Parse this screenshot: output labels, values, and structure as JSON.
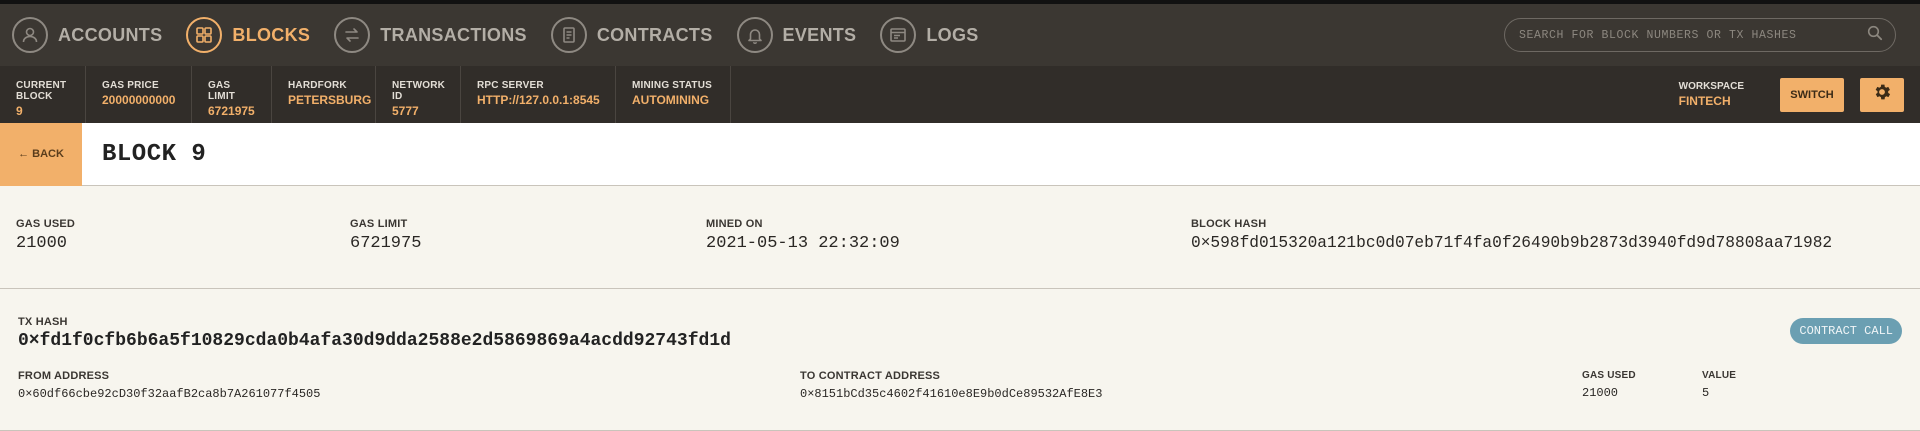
{
  "nav": {
    "items": [
      {
        "label": "ACCOUNTS",
        "icon": "account-icon"
      },
      {
        "label": "BLOCKS",
        "icon": "blocks-icon"
      },
      {
        "label": "TRANSACTIONS",
        "icon": "transactions-icon"
      },
      {
        "label": "CONTRACTS",
        "icon": "contracts-icon"
      },
      {
        "label": "EVENTS",
        "icon": "bell-icon"
      },
      {
        "label": "LOGS",
        "icon": "logs-icon"
      }
    ],
    "active": "BLOCKS",
    "search_placeholder": "SEARCH FOR BLOCK NUMBERS OR TX HASHES"
  },
  "status": {
    "current_block": {
      "label": "CURRENT BLOCK",
      "value": "9"
    },
    "gas_price": {
      "label": "GAS PRICE",
      "value": "20000000000"
    },
    "gas_limit": {
      "label": "GAS LIMIT",
      "value": "6721975"
    },
    "hardfork": {
      "label": "HARDFORK",
      "value": "PETERSBURG"
    },
    "network_id": {
      "label": "NETWORK ID",
      "value": "5777"
    },
    "rpc_server": {
      "label": "RPC SERVER",
      "value": "HTTP://127.0.0.1:8545"
    },
    "mining_status": {
      "label": "MINING STATUS",
      "value": "AUTOMINING"
    },
    "workspace": {
      "label": "WORKSPACE",
      "value": "FINTECH"
    },
    "switch_label": "SWITCH"
  },
  "page": {
    "back_label": "← BACK",
    "title": "BLOCK 9"
  },
  "block": {
    "gas_used": {
      "label": "GAS USED",
      "value": "21000"
    },
    "gas_limit": {
      "label": "GAS LIMIT",
      "value": "6721975"
    },
    "mined_on": {
      "label": "MINED ON",
      "value": "2021-05-13 22:32:09"
    },
    "block_hash": {
      "label": "BLOCK HASH",
      "value": "0×598fd015320a121bc0d07eb71f4fa0f26490b9b2873d3940fd9d78808aa71982"
    }
  },
  "transaction": {
    "hash_label": "TX HASH",
    "hash": "0×fd1f0cfb6b6a5f10829cda0b4afa30d9dda2588e2d5869869a4acdd92743fd1d",
    "type": "CONTRACT CALL",
    "from": {
      "label": "FROM ADDRESS",
      "value": "0×60df66cbe92cD30f32aafB2ca8b7A261077f4505"
    },
    "to": {
      "label": "TO CONTRACT ADDRESS",
      "value": "0×8151bCd35c4602f41610e8E9b0dCe89532AfE8E3"
    },
    "gas_used": {
      "label": "GAS USED",
      "value": "21000"
    },
    "value": {
      "label": "VALUE",
      "value": "5"
    }
  },
  "colors": {
    "accent": "#f2b06a",
    "nav_bg": "#3b3732",
    "status_bg": "#312d29",
    "badge": "#6b9fb2"
  }
}
